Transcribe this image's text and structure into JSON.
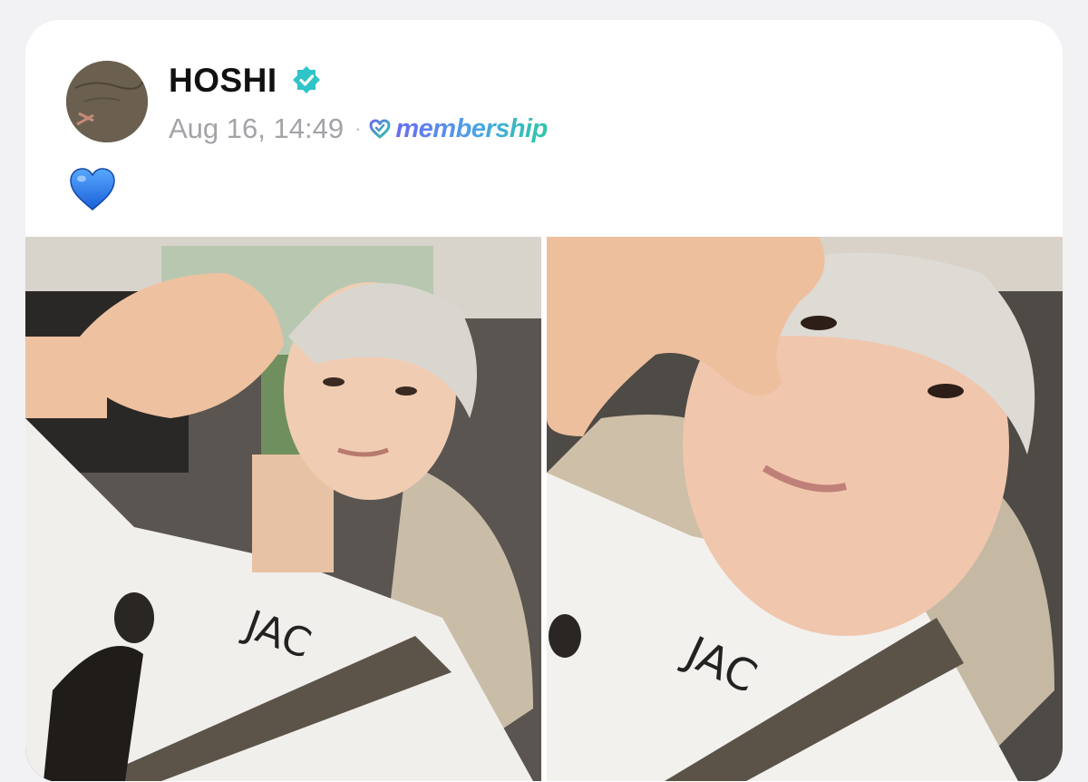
{
  "post": {
    "author": "HOSHI",
    "verified": true,
    "timestamp": "Aug 16, 14:49",
    "separator": "·",
    "badge": "membership",
    "body_emoji": "blue-heart"
  },
  "icons": {
    "verified": "verified-badge-icon",
    "membership": "membership-heart-icon",
    "avatar": "profile-avatar"
  },
  "colors": {
    "verified": "#2ec4c8",
    "heart": "#2e7df2",
    "membership_gradient": [
      "#6a6cf0",
      "#2fc7a8"
    ]
  },
  "photos": [
    {
      "name": "selfie-photo-1"
    },
    {
      "name": "selfie-photo-2"
    }
  ]
}
